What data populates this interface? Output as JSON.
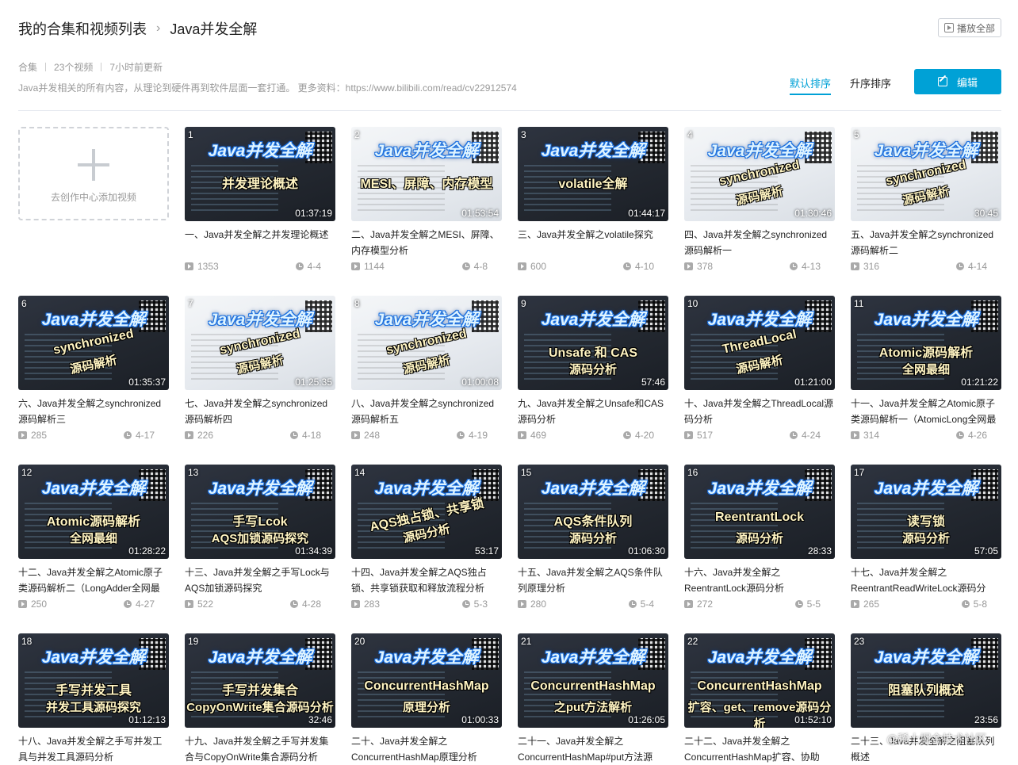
{
  "header": {
    "root": "我的合集和视频列表",
    "separator": "›",
    "current": "Java并发全解"
  },
  "play_all_label": "播放全部",
  "meta": {
    "type": "合集",
    "count": "23个视频",
    "updated": "7小时前更新"
  },
  "description": "Java并发相关的所有内容，从理论到硬件再到软件层面一套打通。 更多资料：https://www.bilibili.com/read/cv22912574",
  "sort": {
    "default": "默认排序",
    "asc": "升序排序"
  },
  "edit_label": "编辑",
  "add_video": "去创作中心添加视频",
  "watermark": "@稀土掘金技术社区",
  "videos": [
    {
      "num": "1",
      "thumb_title": "Java并发全解",
      "thumb_sub": "并发理论概述",
      "thumb_sub2": "",
      "duration": "01:37:19",
      "title": "一、Java并发全解之并发理论概述",
      "views": "1353",
      "date": "4-4",
      "theme": "dark"
    },
    {
      "num": "2",
      "thumb_title": "Java并发全解",
      "thumb_sub": "MESI、屏障、内存模型",
      "thumb_sub2": "",
      "duration": "01:53:54",
      "title": "二、Java并发全解之MESI、屏障、内存模型分析",
      "views": "1144",
      "date": "4-8",
      "theme": "light"
    },
    {
      "num": "3",
      "thumb_title": "Java并发全解",
      "thumb_sub": "volatile全解",
      "thumb_sub2": "",
      "duration": "01:44:17",
      "title": "三、Java并发全解之volatile探究",
      "views": "600",
      "date": "4-10",
      "theme": "dark"
    },
    {
      "num": "4",
      "thumb_title": "Java并发全解",
      "thumb_sub": "synchronized",
      "thumb_sub2": "源码解析",
      "duration": "01:30:46",
      "title": "四、Java并发全解之synchronized源码解析一",
      "views": "378",
      "date": "4-13",
      "theme": "light"
    },
    {
      "num": "5",
      "thumb_title": "Java并发全解",
      "thumb_sub": "synchronized",
      "thumb_sub2": "源码解析",
      "duration": "30:45",
      "title": "五、Java并发全解之synchronized源码解析二",
      "views": "316",
      "date": "4-14",
      "theme": "light"
    },
    {
      "num": "6",
      "thumb_title": "Java并发全解",
      "thumb_sub": "synchronized",
      "thumb_sub2": "源码解析",
      "duration": "01:35:37",
      "title": "六、Java并发全解之synchronized源码解析三",
      "views": "285",
      "date": "4-17",
      "theme": "dark"
    },
    {
      "num": "7",
      "thumb_title": "Java并发全解",
      "thumb_sub": "synchronized",
      "thumb_sub2": "源码解析",
      "duration": "01:25:35",
      "title": "七、Java并发全解之synchronized源码解析四",
      "views": "226",
      "date": "4-18",
      "theme": "light"
    },
    {
      "num": "8",
      "thumb_title": "Java并发全解",
      "thumb_sub": "synchronized",
      "thumb_sub2": "源码解析",
      "duration": "01:00:08",
      "title": "八、Java并发全解之synchronized源码解析五",
      "views": "248",
      "date": "4-19",
      "theme": "light"
    },
    {
      "num": "9",
      "thumb_title": "Java并发全解",
      "thumb_sub": "Unsafe 和 CAS",
      "thumb_sub2": "源码分析",
      "duration": "57:46",
      "title": "九、Java并发全解之Unsafe和CAS源码分析",
      "views": "469",
      "date": "4-20",
      "theme": "dark"
    },
    {
      "num": "10",
      "thumb_title": "Java并发全解",
      "thumb_sub": "ThreadLocal",
      "thumb_sub2": "源码解析",
      "duration": "01:21:00",
      "title": "十、Java并发全解之ThreadLocal源码分析",
      "views": "517",
      "date": "4-24",
      "theme": "dark"
    },
    {
      "num": "11",
      "thumb_title": "Java并发全解",
      "thumb_sub": "Atomic源码解析",
      "thumb_sub2": "全网最细",
      "duration": "01:21:22",
      "title": "十一、Java并发全解之Atomic原子类源码解析一（AtomicLong全网最",
      "views": "314",
      "date": "4-26",
      "theme": "dark"
    },
    {
      "num": "12",
      "thumb_title": "Java并发全解",
      "thumb_sub": "Atomic源码解析",
      "thumb_sub2": "全网最细",
      "duration": "01:28:22",
      "title": "十二、Java并发全解之Atomic原子类源码解析二（LongAdder全网最",
      "views": "250",
      "date": "4-27",
      "theme": "dark"
    },
    {
      "num": "13",
      "thumb_title": "Java并发全解",
      "thumb_sub": "手写Lcok",
      "thumb_sub2": "AQS加锁源码探究",
      "duration": "01:34:39",
      "title": "十三、Java并发全解之手写Lock与AQS加锁源码探究",
      "views": "522",
      "date": "4-28",
      "theme": "dark"
    },
    {
      "num": "14",
      "thumb_title": "Java并发全解",
      "thumb_sub": "AQS独占锁、共享锁",
      "thumb_sub2": "源码分析",
      "duration": "53:17",
      "title": "十四、Java并发全解之AQS独占锁、共享锁获取和释放流程分析",
      "views": "283",
      "date": "5-3",
      "theme": "dark"
    },
    {
      "num": "15",
      "thumb_title": "Java并发全解",
      "thumb_sub": "AQS条件队列",
      "thumb_sub2": "源码分析",
      "duration": "01:06:30",
      "title": "十五、Java并发全解之AQS条件队列原理分析",
      "views": "280",
      "date": "5-4",
      "theme": "dark"
    },
    {
      "num": "16",
      "thumb_title": "Java并发全解",
      "thumb_sub": "ReentrantLock",
      "thumb_sub2": "源码分析",
      "duration": "28:33",
      "title": "十六、Java并发全解之ReentrantLock源码分析",
      "views": "272",
      "date": "5-5",
      "theme": "dark"
    },
    {
      "num": "17",
      "thumb_title": "Java并发全解",
      "thumb_sub": "读写锁",
      "thumb_sub2": "源码分析",
      "duration": "57:05",
      "title": "十七、Java并发全解之ReentrantReadWriteLock源码分",
      "views": "265",
      "date": "5-8",
      "theme": "dark"
    },
    {
      "num": "18",
      "thumb_title": "Java并发全解",
      "thumb_sub": "手写并发工具",
      "thumb_sub2": "并发工具源码探究",
      "duration": "01:12:13",
      "title": "十八、Java并发全解之手写并发工具与并发工具源码分析",
      "views": "",
      "date": "",
      "theme": "dark"
    },
    {
      "num": "19",
      "thumb_title": "Java并发全解",
      "thumb_sub": "手写并发集合",
      "thumb_sub2": "CopyOnWrite集合源码分析",
      "duration": "32:46",
      "title": "十九、Java并发全解之手写并发集合与CopyOnWrite集合源码分析",
      "views": "",
      "date": "",
      "theme": "dark"
    },
    {
      "num": "20",
      "thumb_title": "Java并发全解",
      "thumb_sub": "ConcurrentHashMap",
      "thumb_sub2": "原理分析",
      "duration": "01:00:33",
      "title": "二十、Java并发全解之ConcurrentHashMap原理分析",
      "views": "",
      "date": "",
      "theme": "dark"
    },
    {
      "num": "21",
      "thumb_title": "Java并发全解",
      "thumb_sub": "ConcurrentHashMap",
      "thumb_sub2": "之put方法解析",
      "duration": "01:26:05",
      "title": "二十一、Java并发全解之ConcurrentHashMap#put方法源",
      "views": "",
      "date": "",
      "theme": "dark"
    },
    {
      "num": "22",
      "thumb_title": "Java并发全解",
      "thumb_sub": "ConcurrentHashMap",
      "thumb_sub2": "扩容、get、remove源码分析",
      "duration": "01:52:10",
      "title": "二十二、Java并发全解之ConcurrentHashMap扩容、协助",
      "views": "",
      "date": "",
      "theme": "dark"
    },
    {
      "num": "23",
      "thumb_title": "Java并发全解",
      "thumb_sub": "阻塞队列概述",
      "thumb_sub2": "",
      "duration": "23:56",
      "title": "二十三、Java并发全解之阻塞队列概述",
      "views": "",
      "date": "",
      "theme": "dark"
    }
  ]
}
